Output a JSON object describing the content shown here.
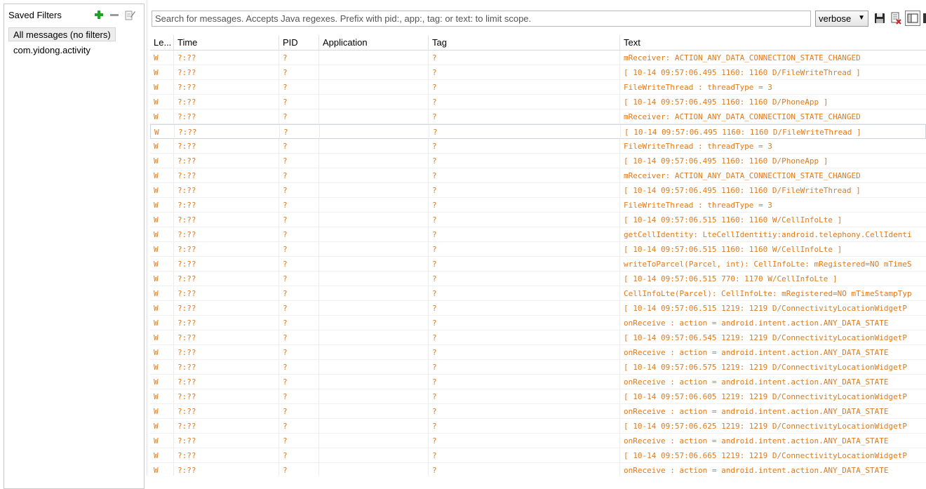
{
  "sidebar": {
    "title": "Saved Filters",
    "filters": [
      "All messages (no filters)",
      "com.yidong.activity"
    ],
    "selected_index": 0
  },
  "toolbar": {
    "search_placeholder": "Search for messages. Accepts Java regexes. Prefix with pid:, app:, tag: or text: to limit scope.",
    "level": "verbose"
  },
  "table": {
    "columns": [
      "Le...",
      "Time",
      "PID",
      "Application",
      "Tag",
      "Text"
    ],
    "selected_row": 5,
    "rows": [
      [
        "W",
        "?:??",
        "?",
        "",
        "?",
        "mReceiver: ACTION_ANY_DATA_CONNECTION_STATE_CHANGED"
      ],
      [
        "W",
        "?:??",
        "?",
        "",
        "?",
        "[ 10-14 09:57:06.495  1160: 1160 D/FileWriteThread ]"
      ],
      [
        "W",
        "?:??",
        "?",
        "",
        "?",
        "FileWriteThread : threadType = 3"
      ],
      [
        "W",
        "?:??",
        "?",
        "",
        "?",
        "[ 10-14 09:57:06.495  1160: 1160 D/PhoneApp ]"
      ],
      [
        "W",
        "?:??",
        "?",
        "",
        "?",
        "mReceiver: ACTION_ANY_DATA_CONNECTION_STATE_CHANGED"
      ],
      [
        "W",
        "?:??",
        "?",
        "",
        "?",
        "[ 10-14 09:57:06.495  1160: 1160 D/FileWriteThread ]"
      ],
      [
        "W",
        "?:??",
        "?",
        "",
        "?",
        "FileWriteThread : threadType = 3"
      ],
      [
        "W",
        "?:??",
        "?",
        "",
        "?",
        "[ 10-14 09:57:06.495  1160: 1160 D/PhoneApp ]"
      ],
      [
        "W",
        "?:??",
        "?",
        "",
        "?",
        "mReceiver: ACTION_ANY_DATA_CONNECTION_STATE_CHANGED"
      ],
      [
        "W",
        "?:??",
        "?",
        "",
        "?",
        "[ 10-14 09:57:06.495  1160: 1160 D/FileWriteThread ]"
      ],
      [
        "W",
        "?:??",
        "?",
        "",
        "?",
        "FileWriteThread : threadType = 3"
      ],
      [
        "W",
        "?:??",
        "?",
        "",
        "?",
        "[ 10-14 09:57:06.515  1160: 1160 W/CellInfoLte ]"
      ],
      [
        "W",
        "?:??",
        "?",
        "",
        "?",
        "getCellIdentity: LteCellIdentitiy:android.telephony.CellIdenti"
      ],
      [
        "W",
        "?:??",
        "?",
        "",
        "?",
        "[ 10-14 09:57:06.515  1160: 1160 W/CellInfoLte ]"
      ],
      [
        "W",
        "?:??",
        "?",
        "",
        "?",
        "writeToParcel(Parcel, int): CellInfoLte: mRegistered=NO mTimeS"
      ],
      [
        "W",
        "?:??",
        "?",
        "",
        "?",
        "[ 10-14 09:57:06.515   770: 1170 W/CellInfoLte ]"
      ],
      [
        "W",
        "?:??",
        "?",
        "",
        "?",
        "CellInfoLte(Parcel): CellInfoLte: mRegistered=NO mTimeStampTyp"
      ],
      [
        "W",
        "?:??",
        "?",
        "",
        "?",
        "[ 10-14 09:57:06.515  1219: 1219 D/ConnectivityLocationWidgetP"
      ],
      [
        "W",
        "?:??",
        "?",
        "",
        "?",
        "onReceive : action = android.intent.action.ANY_DATA_STATE"
      ],
      [
        "W",
        "?:??",
        "?",
        "",
        "?",
        "[ 10-14 09:57:06.545  1219: 1219 D/ConnectivityLocationWidgetP"
      ],
      [
        "W",
        "?:??",
        "?",
        "",
        "?",
        "onReceive : action = android.intent.action.ANY_DATA_STATE"
      ],
      [
        "W",
        "?:??",
        "?",
        "",
        "?",
        "[ 10-14 09:57:06.575  1219: 1219 D/ConnectivityLocationWidgetP"
      ],
      [
        "W",
        "?:??",
        "?",
        "",
        "?",
        "onReceive : action = android.intent.action.ANY_DATA_STATE"
      ],
      [
        "W",
        "?:??",
        "?",
        "",
        "?",
        "[ 10-14 09:57:06.605  1219: 1219 D/ConnectivityLocationWidgetP"
      ],
      [
        "W",
        "?:??",
        "?",
        "",
        "?",
        "onReceive : action = android.intent.action.ANY_DATA_STATE"
      ],
      [
        "W",
        "?:??",
        "?",
        "",
        "?",
        "[ 10-14 09:57:06.625  1219: 1219 D/ConnectivityLocationWidgetP"
      ],
      [
        "W",
        "?:??",
        "?",
        "",
        "?",
        "onReceive : action = android.intent.action.ANY_DATA_STATE"
      ],
      [
        "W",
        "?:??",
        "?",
        "",
        "?",
        "[ 10-14 09:57:06.665  1219: 1219 D/ConnectivityLocationWidgetP"
      ],
      [
        "W",
        "?:??",
        "?",
        "",
        "?",
        "onReceive : action = android.intent.action.ANY_DATA_STATE"
      ]
    ]
  },
  "icons": {
    "add": "plus-icon",
    "remove": "minus-icon",
    "edit": "edit-filter-icon",
    "save": "save-icon",
    "clear": "clear-log-icon",
    "toggle": "panel-toggle-icon"
  },
  "colors": {
    "warning_text": "#e07a1c",
    "add_green": "#1ea31e"
  }
}
